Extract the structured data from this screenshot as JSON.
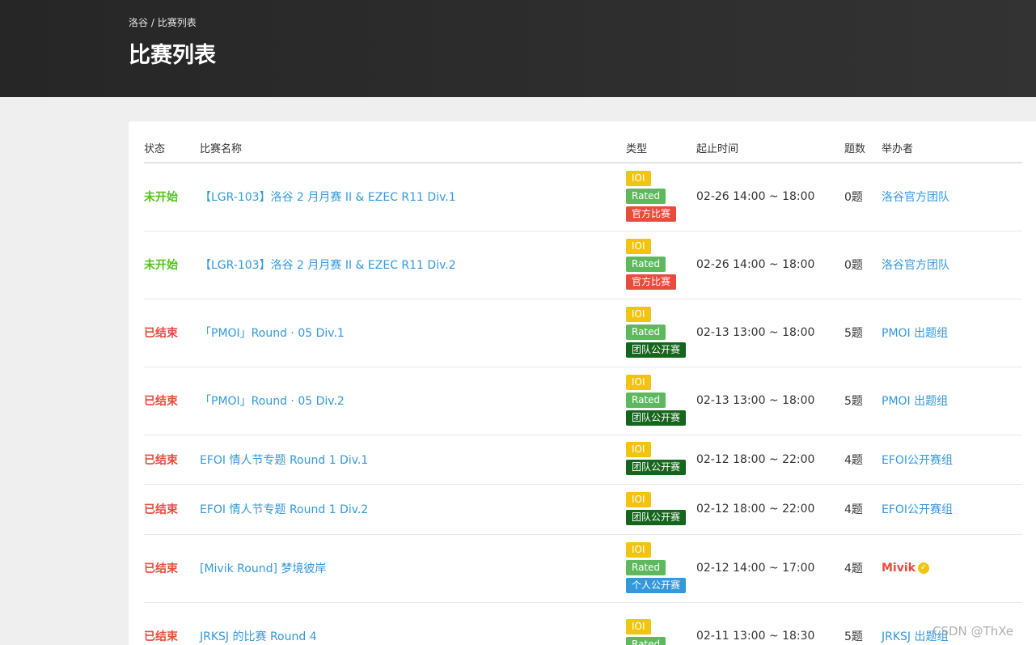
{
  "header": {
    "breadcrumb": [
      "洛谷",
      "比赛列表"
    ],
    "breadcrumb_sep": "/",
    "title": "比赛列表"
  },
  "columns": {
    "status": "状态",
    "name": "比赛名称",
    "type": "类型",
    "time": "起止时间",
    "count": "题数",
    "host": "举办者"
  },
  "colors": {
    "status_upcoming": "#52c41a",
    "status_ended": "#e74c3c",
    "link": "#3498db",
    "tag_ioi": "#f1c40f",
    "tag_rated": "#5eb95e",
    "tag_official": "#e74c3c",
    "tag_team": "#14661c",
    "tag_personal": "#3498db",
    "host_special": "#e74c3c"
  },
  "rows": [
    {
      "status": "未开始",
      "status_kind": "upcoming",
      "name": "【LGR-103】洛谷 2 月月赛 II & EZEC R11 Div.1",
      "tags": [
        {
          "label": "IOI",
          "kind": "ioi"
        },
        {
          "label": "Rated",
          "kind": "rated"
        },
        {
          "label": "官方比赛",
          "kind": "official"
        }
      ],
      "time": "02-26 14:00 ~ 18:00",
      "count": "0题",
      "host": "洛谷官方团队",
      "host_special": false
    },
    {
      "status": "未开始",
      "status_kind": "upcoming",
      "name": "【LGR-103】洛谷 2 月月赛 II & EZEC R11 Div.2",
      "tags": [
        {
          "label": "IOI",
          "kind": "ioi"
        },
        {
          "label": "Rated",
          "kind": "rated"
        },
        {
          "label": "官方比赛",
          "kind": "official"
        }
      ],
      "time": "02-26 14:00 ~ 18:00",
      "count": "0题",
      "host": "洛谷官方团队",
      "host_special": false
    },
    {
      "status": "已结束",
      "status_kind": "ended",
      "name": "「PMOI」Round · 05 Div.1",
      "tags": [
        {
          "label": "IOI",
          "kind": "ioi"
        },
        {
          "label": "Rated",
          "kind": "rated"
        },
        {
          "label": "团队公开赛",
          "kind": "team"
        }
      ],
      "time": "02-13 13:00 ~ 18:00",
      "count": "5题",
      "host": "PMOI 出题组",
      "host_special": false
    },
    {
      "status": "已结束",
      "status_kind": "ended",
      "name": "「PMOI」Round · 05 Div.2",
      "tags": [
        {
          "label": "IOI",
          "kind": "ioi"
        },
        {
          "label": "Rated",
          "kind": "rated"
        },
        {
          "label": "团队公开赛",
          "kind": "team"
        }
      ],
      "time": "02-13 13:00 ~ 18:00",
      "count": "5题",
      "host": "PMOI 出题组",
      "host_special": false
    },
    {
      "status": "已结束",
      "status_kind": "ended",
      "name": "EFOI 情人节专题 Round 1 Div.1",
      "tags": [
        {
          "label": "IOI",
          "kind": "ioi"
        },
        {
          "label": "团队公开赛",
          "kind": "team"
        }
      ],
      "time": "02-12 18:00 ~ 22:00",
      "count": "4题",
      "host": "EFOI公开赛组",
      "host_special": false
    },
    {
      "status": "已结束",
      "status_kind": "ended",
      "name": "EFOI 情人节专题 Round 1 Div.2",
      "tags": [
        {
          "label": "IOI",
          "kind": "ioi"
        },
        {
          "label": "团队公开赛",
          "kind": "team"
        }
      ],
      "time": "02-12 18:00 ~ 22:00",
      "count": "4题",
      "host": "EFOI公开赛组",
      "host_special": false
    },
    {
      "status": "已结束",
      "status_kind": "ended",
      "name": "[Mivik Round] 梦境彼岸",
      "tags": [
        {
          "label": "IOI",
          "kind": "ioi"
        },
        {
          "label": "Rated",
          "kind": "rated"
        },
        {
          "label": "个人公开赛",
          "kind": "personal"
        }
      ],
      "time": "02-12 14:00 ~ 17:00",
      "count": "4题",
      "host": "Mivik",
      "host_special": true,
      "host_badge": "verified-check-icon"
    },
    {
      "status": "已结束",
      "status_kind": "ended",
      "name": "JRKSJ 的比赛 Round 4",
      "tags": [
        {
          "label": "IOI",
          "kind": "ioi"
        },
        {
          "label": "Rated",
          "kind": "rated"
        }
      ],
      "time": "02-11 13:00 ~ 18:30",
      "count": "5题",
      "host": "JRKSJ 出题组",
      "host_special": false
    }
  ],
  "watermark": "CSDN @ThXe"
}
